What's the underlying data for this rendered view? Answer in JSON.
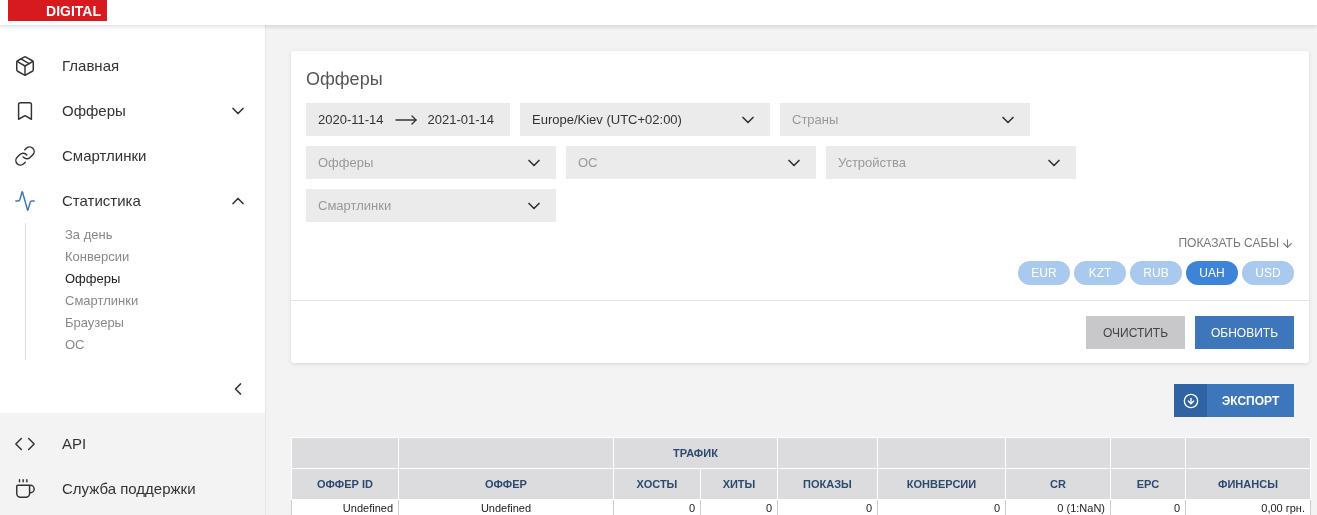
{
  "header": {
    "logo": "DIGITAL"
  },
  "sidebar": {
    "items": [
      {
        "label": "Главная",
        "active": false
      },
      {
        "label": "Офферы",
        "active": false,
        "expanded": false
      },
      {
        "label": "Смартлинки",
        "active": false
      },
      {
        "label": "Статистика",
        "active": true,
        "expanded": true,
        "children": [
          {
            "label": "За день",
            "selected": false
          },
          {
            "label": "Конверсии",
            "selected": false
          },
          {
            "label": "Офферы",
            "selected": true
          },
          {
            "label": "Смартлинки",
            "selected": false
          },
          {
            "label": "Браузеры",
            "selected": false
          },
          {
            "label": "ОС",
            "selected": false
          }
        ]
      }
    ],
    "bottom_items": [
      {
        "label": "API"
      },
      {
        "label": "Служба поддержки"
      }
    ]
  },
  "filters": {
    "title": "Офферы",
    "date_from": "2020-11-14",
    "date_to": "2021-01-14",
    "selects": [
      {
        "value": "Europe/Kiev (UTC+02:00)"
      },
      {
        "placeholder": "Страны"
      },
      {
        "placeholder": "Офферы"
      },
      {
        "placeholder": "ОС"
      },
      {
        "placeholder": "Устройства"
      },
      {
        "placeholder": "Смартлинки"
      }
    ],
    "show_subs": "ПОКАЗАТЬ САБЫ",
    "currencies": [
      {
        "label": "EUR",
        "selected": false
      },
      {
        "label": "KZT",
        "selected": false
      },
      {
        "label": "RUB",
        "selected": false
      },
      {
        "label": "UAH",
        "selected": true
      },
      {
        "label": "USD",
        "selected": false
      }
    ],
    "buttons": [
      "ОЧИСТИТЬ",
      "ОБНОВИТЬ"
    ]
  },
  "export_button": "ЭКСПОРТ",
  "table": {
    "group_label": "ТРАФИК",
    "columns": [
      {
        "label": "ОФФЕР ID",
        "in_group": false
      },
      {
        "label": "ОФФЕР",
        "in_group": false
      },
      {
        "label": "ХОСТЫ",
        "in_group": true
      },
      {
        "label": "ХИТЫ",
        "in_group": true
      },
      {
        "label": "ПОКАЗЫ",
        "in_group": false
      },
      {
        "label": "КОНВЕРСИИ",
        "in_group": false
      },
      {
        "label": "CR",
        "in_group": false
      },
      {
        "label": "EPC",
        "in_group": false
      },
      {
        "label": "ФИНАНСЫ",
        "in_group": false
      }
    ],
    "rows": [
      [
        "Undefined",
        "Undefined",
        "0",
        "0",
        "0",
        "0",
        "0 (1:NaN)",
        "0",
        "0,00 грн."
      ]
    ]
  }
}
